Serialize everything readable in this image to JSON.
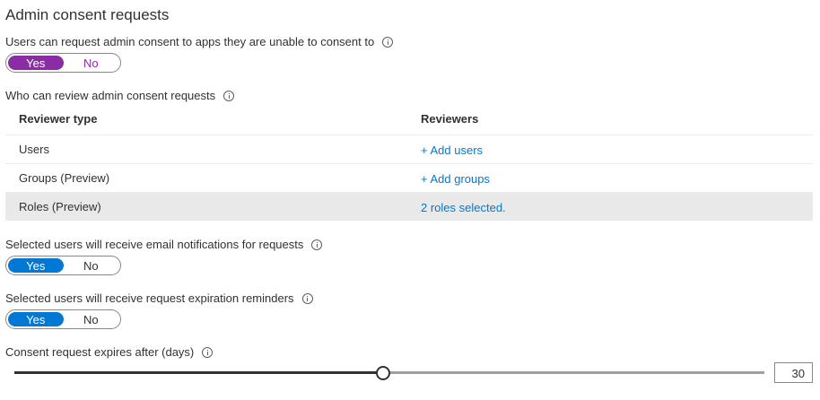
{
  "section_title": "Admin consent requests",
  "consent_request": {
    "label": "Users can request admin consent to apps they are unable to consent to",
    "yes": "Yes",
    "no": "No",
    "selected": "Yes",
    "accent": "#8a2da5"
  },
  "reviewers": {
    "label": "Who can review admin consent requests",
    "col_type": "Reviewer type",
    "col_reviewers": "Reviewers",
    "rows": [
      {
        "type": "Users",
        "action": "+ Add users"
      },
      {
        "type": "Groups (Preview)",
        "action": "+ Add groups"
      },
      {
        "type": "Roles (Preview)",
        "action": "2 roles selected."
      }
    ]
  },
  "email_notifications": {
    "label": "Selected users will receive email notifications for requests",
    "yes": "Yes",
    "no": "No",
    "selected": "Yes",
    "accent": "#0078d4"
  },
  "expiration_reminders": {
    "label": "Selected users will receive request expiration reminders",
    "yes": "Yes",
    "no": "No",
    "selected": "Yes",
    "accent": "#0078d4"
  },
  "expiry": {
    "label": "Consent request expires after (days)",
    "value": "30",
    "min": 1,
    "max": 60
  }
}
